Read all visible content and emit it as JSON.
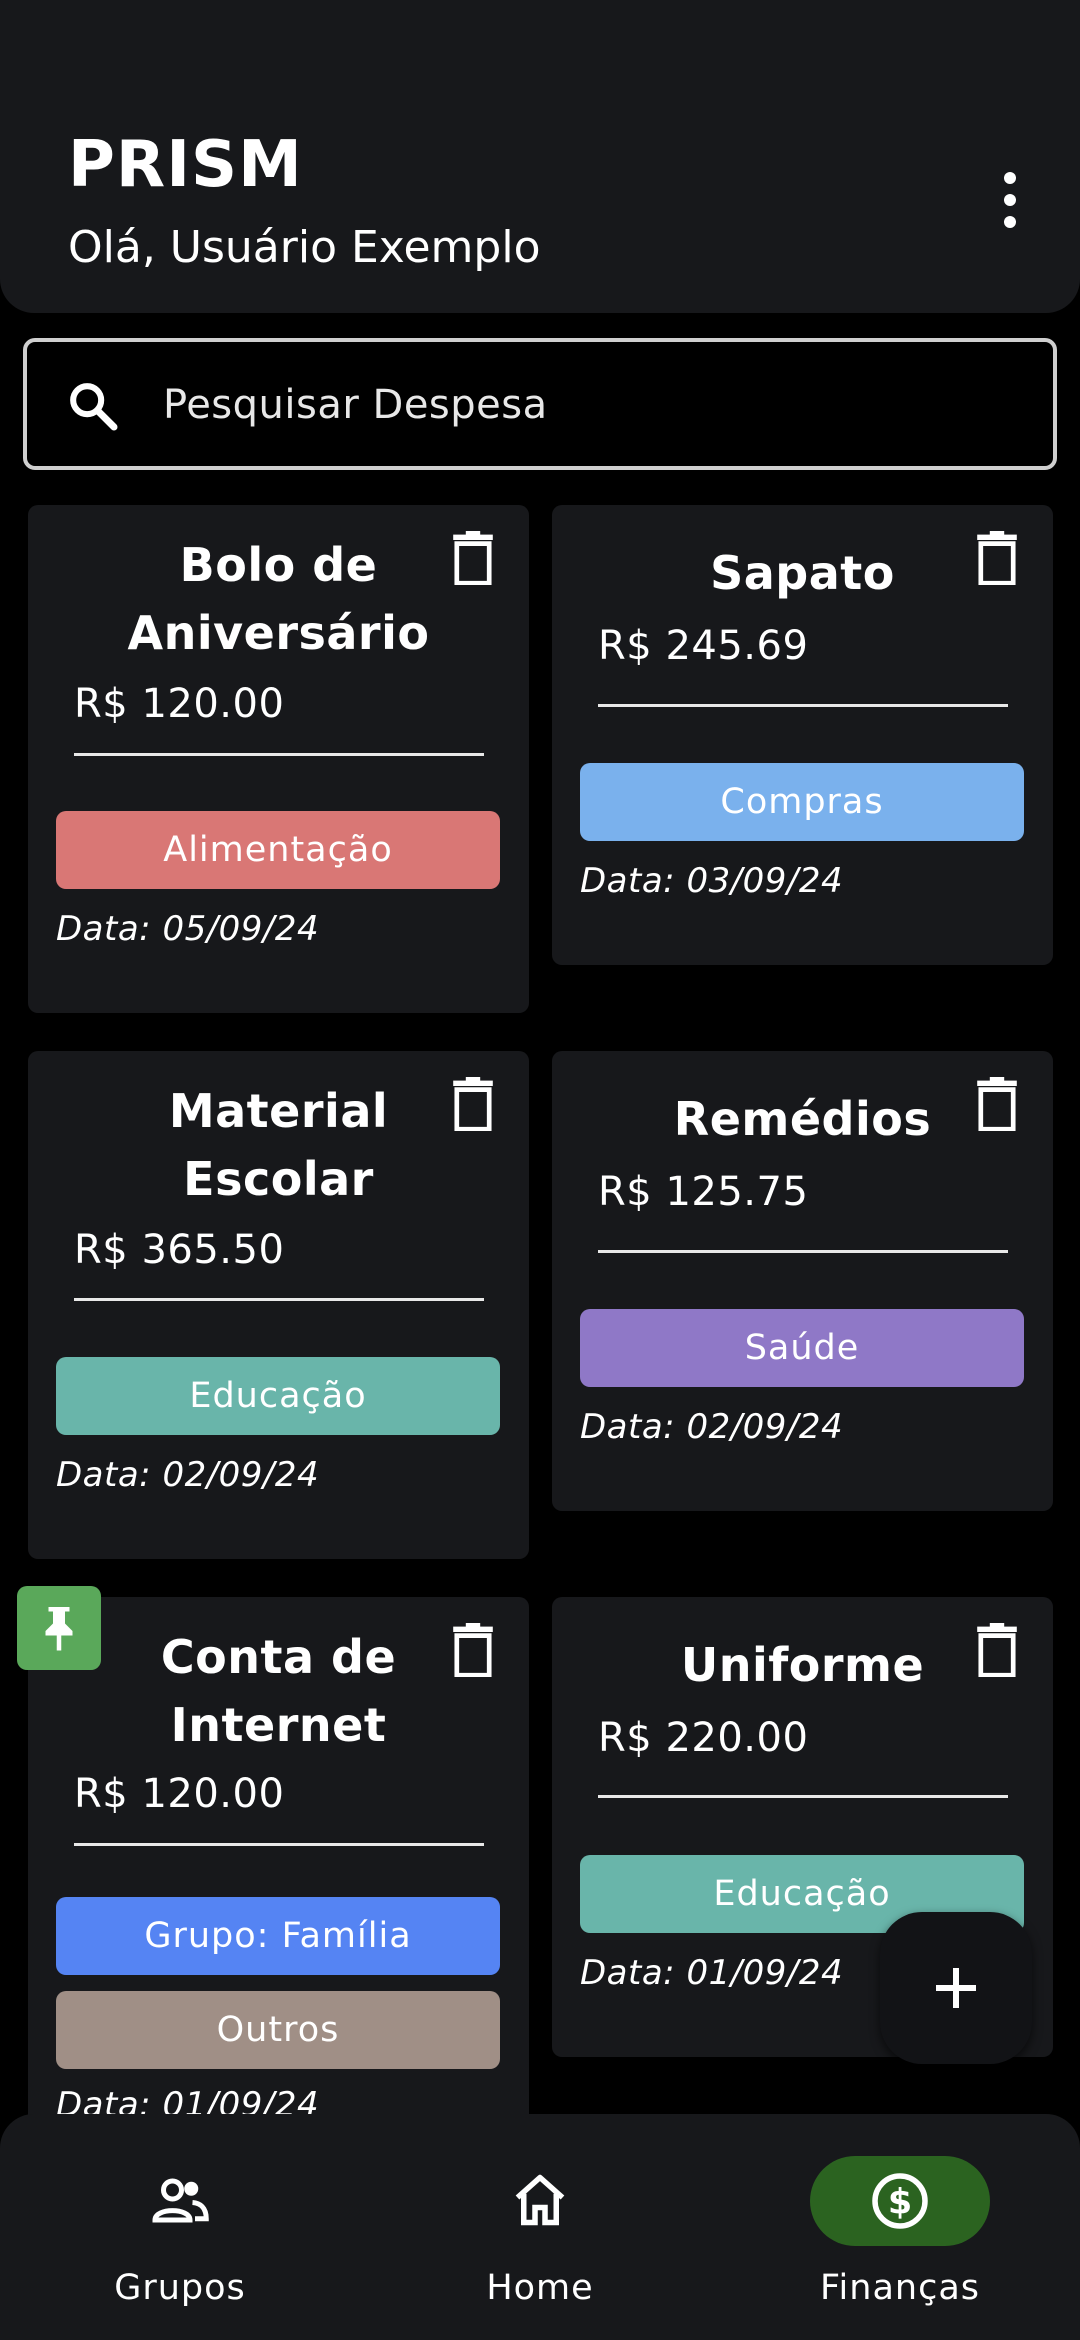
{
  "header": {
    "title": "PRISM",
    "greeting": "Olá, Usuário Exemplo"
  },
  "search": {
    "placeholder": "Pesquisar Despesa"
  },
  "expenses": [
    {
      "title": "Bolo de Aniversário",
      "title_lines": [
        "Bolo de",
        "Aniversário"
      ],
      "amount": "R$ 120.00",
      "tags": [
        {
          "label": "Alimentação",
          "color": "#d97775"
        }
      ],
      "date": "Data: 05/09/24",
      "pinned": false
    },
    {
      "title": "Sapato",
      "title_lines": [
        "Sapato"
      ],
      "amount": "R$ 245.69",
      "tags": [
        {
          "label": "Compras",
          "color": "#7ab1ed"
        }
      ],
      "date": "Data: 03/09/24",
      "pinned": false
    },
    {
      "title": "Material Escolar",
      "title_lines": [
        "Material",
        "Escolar"
      ],
      "amount": "R$ 365.50",
      "tags": [
        {
          "label": "Educação",
          "color": "#69b5aa"
        }
      ],
      "date": "Data: 02/09/24",
      "pinned": false
    },
    {
      "title": "Remédios",
      "title_lines": [
        "Remédios"
      ],
      "amount": "R$ 125.75",
      "tags": [
        {
          "label": "Saúde",
          "color": "#8f78c7"
        }
      ],
      "date": "Data: 02/09/24",
      "pinned": false
    },
    {
      "title": "Conta de Internet",
      "title_lines": [
        "Conta de",
        "Internet"
      ],
      "amount": "R$ 120.00",
      "tags": [
        {
          "label": "Grupo: Família",
          "color": "#5584f3"
        },
        {
          "label": "Outros",
          "color": "#a08f86"
        }
      ],
      "date": "Data: 01/09/24",
      "pinned": true
    },
    {
      "title": "Uniforme",
      "title_lines": [
        "Uniforme"
      ],
      "amount": "R$ 220.00",
      "tags": [
        {
          "label": "Educação",
          "color": "#69b5aa"
        }
      ],
      "date": "Data: 01/09/24",
      "pinned": false
    }
  ],
  "icons": {
    "search": "search-icon",
    "delete": "trash-icon",
    "pin": "pin-icon",
    "menu": "more-vert-icon",
    "add": "plus-icon"
  },
  "colors": {
    "active_nav": "#2b6320",
    "pin_badge": "#5aa85a",
    "card_bg": "#17181b"
  },
  "bottom_nav": {
    "items": [
      {
        "label": "Grupos",
        "icon": "groups-icon",
        "active": false
      },
      {
        "label": "Home",
        "icon": "home-icon",
        "active": false
      },
      {
        "label": "Finanças",
        "icon": "dollar-circle-icon",
        "active": true
      }
    ]
  }
}
